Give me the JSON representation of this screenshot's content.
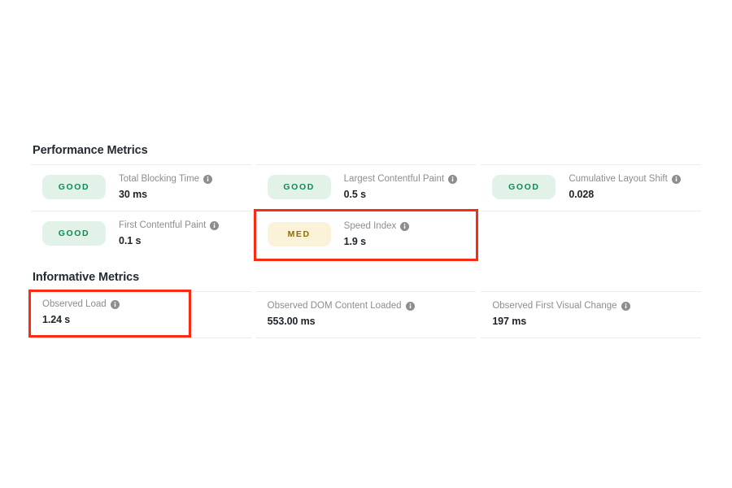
{
  "colors": {
    "good_badge_bg": "#e2f2e9",
    "good_badge_text": "#0d8a4f",
    "med_badge_bg": "#fbf2da",
    "med_badge_text": "#8a6d09",
    "highlight_border": "#fa2a15",
    "divider": "#ececec",
    "label_text": "#8d8d8d",
    "value_text": "#1d2329",
    "heading_text": "#232b33"
  },
  "icons": {
    "info": "info-icon"
  },
  "performance": {
    "title": "Performance Metrics",
    "metrics": [
      {
        "badge": "GOOD",
        "badge_kind": "good",
        "label": "Total Blocking Time",
        "value": "30 ms",
        "highlighted": false
      },
      {
        "badge": "GOOD",
        "badge_kind": "good",
        "label": "Largest Contentful Paint",
        "value": "0.5 s",
        "highlighted": false
      },
      {
        "badge": "GOOD",
        "badge_kind": "good",
        "label": "Cumulative Layout Shift",
        "value": "0.028",
        "highlighted": false
      },
      {
        "badge": "GOOD",
        "badge_kind": "good",
        "label": "First Contentful Paint",
        "value": "0.1 s",
        "highlighted": false
      },
      {
        "badge": "MED",
        "badge_kind": "med",
        "label": "Speed Index",
        "value": "1.9 s",
        "highlighted": true
      }
    ]
  },
  "informative": {
    "title": "Informative Metrics",
    "metrics": [
      {
        "label": "Observed Load",
        "value": "1.24 s",
        "highlighted": true
      },
      {
        "label": "Observed DOM Content Loaded",
        "value": "553.00 ms",
        "highlighted": false
      },
      {
        "label": "Observed First Visual Change",
        "value": "197 ms",
        "highlighted": false
      }
    ]
  }
}
